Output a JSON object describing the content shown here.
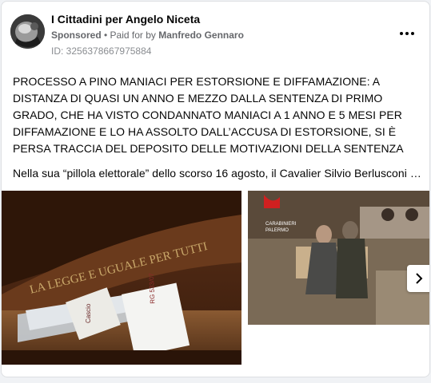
{
  "post": {
    "page_name": "I Cittadini per Angelo Niceta",
    "sponsored": "Sponsored",
    "separator": " • ",
    "paid_for_by": "Paid for by ",
    "payer": "Manfredo Gennaro",
    "ad_id": "ID: 3256378667975884",
    "headline": "PROCESSO A PINO MANIACI PER ESTORSIONE E DIFFAMAZIONE: A DISTANZA DI QUASI UN ANNO E MEZZO DALLA SENTENZA DI PRIMO GRADO, CHE HA VISTO CONDANNATO MANIACI A 1 ANNO E 5 MESI PER DIFFAMAZIONE E LO HA ASSOLTO DALL’ACCUSA DI ESTORSIONE, SI È PERSA TRACCIA DEL DEPOSITO DELLE MOTIVAZIONI DELLA SENTENZA",
    "body": "Nella sua “pillola elettorale” dello scorso 16 agosto, il Cavalier Silvio Berlusconi h..."
  },
  "images": {
    "courtroom_inscription": "LA LEGGE E UGUALE PER TUTTI",
    "folder_label_1": "RG 533/07",
    "folder_label_2": "Cascio",
    "video_overlay_line1": "CARABINIERI",
    "video_overlay_line2": "PALERMO"
  },
  "icons": {
    "more": "more-options-icon",
    "next": "chevron-right-icon",
    "avatar": "page-avatar"
  },
  "colors": {
    "card_background": "#ffffff",
    "page_background": "#f0f2f5",
    "secondary_text": "#65676b"
  }
}
